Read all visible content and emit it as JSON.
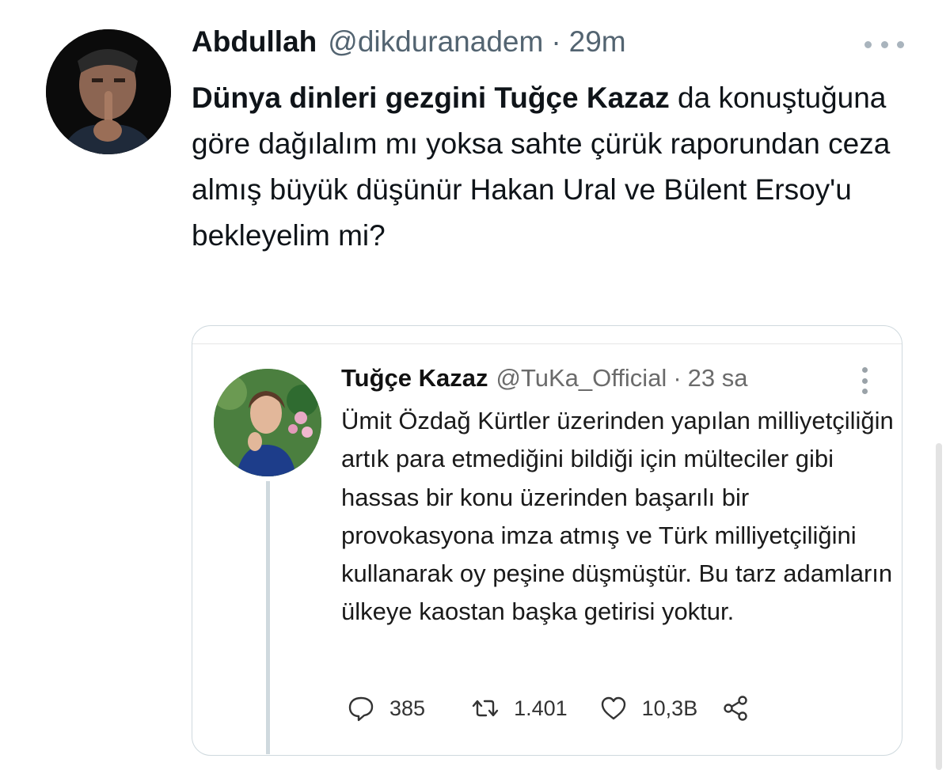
{
  "tweet": {
    "author_name": "Abdullah",
    "author_handle": "@dikduranadem",
    "separator": "·",
    "time": "29m",
    "text_bold": "Dünya dinleri gezgini Tuğçe Kazaz",
    "text_rest": " da konuştuğuna göre dağılalım mı yoksa sahte çürük raporundan ceza almış büyük düşünür Hakan Ural ve Bülent Ersoy'u bekleyelim mi?"
  },
  "quoted_tweet": {
    "author_name": "Tuğçe Kazaz",
    "author_handle": "@TuKa_Official",
    "separator": "·",
    "time": "23 sa",
    "text": "Ümit Özdağ Kürtler üzerinden yapılan milliyetçiliğin artık para etmediğini bildiği için mülteciler gibi hassas bir konu üzerinden başarılı bir provokasyona imza atmış ve Türk milliyetçiliğini kullanarak oy peşine düşmüştür. Bu tarz adamların ülkeye kaostan başka getirisi yoktur.",
    "actions": {
      "replies": "385",
      "retweets": "1.401",
      "likes": "10,3B"
    }
  },
  "icons": {
    "reply": "reply-icon",
    "retweet": "retweet-icon",
    "like": "heart-icon",
    "share": "share-icon",
    "more": "more-icon"
  },
  "colors": {
    "text": "#0f1419",
    "secondary": "#536471",
    "border": "#cfd9de"
  }
}
